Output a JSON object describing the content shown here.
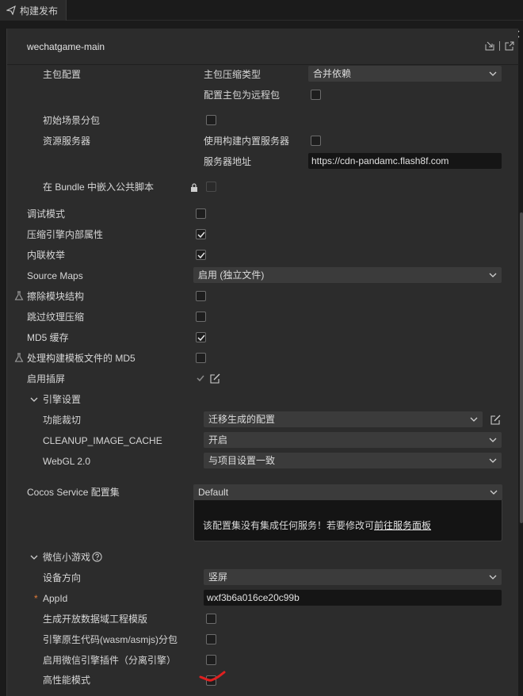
{
  "tab": {
    "label": "构建发布"
  },
  "panel": {
    "title": "wechatgame-main"
  },
  "main_package": {
    "label": "主包配置",
    "compression_label": "主包压缩类型",
    "compression_value": "合并依赖",
    "remote_label": "配置主包为远程包",
    "remote_checked": false
  },
  "initial_scene_subpackage": {
    "label": "初始场景分包",
    "checked": false
  },
  "resource_server": {
    "label": "资源服务器",
    "builtin_label": "使用构建内置服务器",
    "builtin_checked": false,
    "address_label": "服务器地址",
    "address_value": "https://cdn-pandamc.flash8f.com"
  },
  "embed_common_script": {
    "label": "在 Bundle 中嵌入公共脚本",
    "checked": false,
    "locked": true
  },
  "options": [
    {
      "label": "调试模式",
      "checked": false
    },
    {
      "label": "压缩引擎内部属性",
      "checked": true
    },
    {
      "label": "内联枚举",
      "checked": true
    }
  ],
  "source_maps": {
    "label": "Source Maps",
    "value": "启用 (独立文件)"
  },
  "erase_module_structure": {
    "label": "擦除模块结构",
    "checked": false,
    "experimental": true
  },
  "skip_texture_compression": {
    "label": "跳过纹理压缩",
    "checked": false
  },
  "md5_cache": {
    "label": "MD5 缓存",
    "checked": true
  },
  "template_md5": {
    "label": "处理构建模板文件的 MD5",
    "checked": false,
    "experimental": true
  },
  "splash_screen": {
    "label": "启用插屏",
    "checked": true
  },
  "engine_settings": {
    "label": "引擎设置",
    "feature_crop_label": "功能裁切",
    "feature_crop_value": "迁移生成的配置",
    "cleanup_label": "CLEANUP_IMAGE_CACHE",
    "cleanup_value": "开启",
    "webgl_label": "WebGL 2.0",
    "webgl_value": "与项目设置一致"
  },
  "cocos_service": {
    "label": "Cocos Service 配置集",
    "value": "Default",
    "message": "该配置集没有集成任何服务！若要修改可",
    "link": "前往服务面板"
  },
  "wechat_minigame": {
    "label": "微信小游戏",
    "orientation_label": "设备方向",
    "orientation_value": "竖屏",
    "appid_label": "AppId",
    "appid_value": "wxf3b6a016ce20c99b",
    "open_data_label": "生成开放数据域工程模版",
    "open_data_checked": false,
    "wasm_subpackage_label": "引擎原生代码(wasm/asmjs)分包",
    "wasm_subpackage_checked": false,
    "engine_plugin_label": "启用微信引擎插件（分离引擎）",
    "engine_plugin_checked": false,
    "high_perf_label": "高性能模式",
    "high_perf_checked": false
  },
  "colors": {
    "accent_link": "#e4e4e4",
    "required_star": "#e07b39",
    "red_annotation": "#e02020"
  }
}
